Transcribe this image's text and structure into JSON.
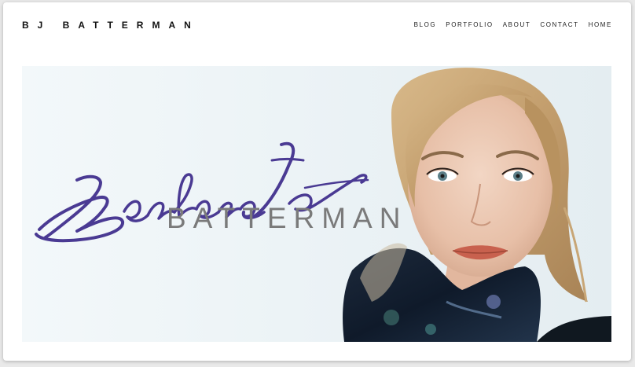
{
  "header": {
    "site_title": "BJ BATTERMAN"
  },
  "nav": {
    "items": [
      {
        "label": "BLOG"
      },
      {
        "label": "PORTFOLIO"
      },
      {
        "label": "ABOUT"
      },
      {
        "label": "CONTACT"
      },
      {
        "label": "HOME"
      }
    ]
  },
  "banner": {
    "surname_text": "BATTERMAN",
    "signature_script_text": "Barbara Jo",
    "colors": {
      "signature_ink": "#4a3a93",
      "surname_gray": "#7a7a7a",
      "background": "#eef4f7"
    }
  }
}
